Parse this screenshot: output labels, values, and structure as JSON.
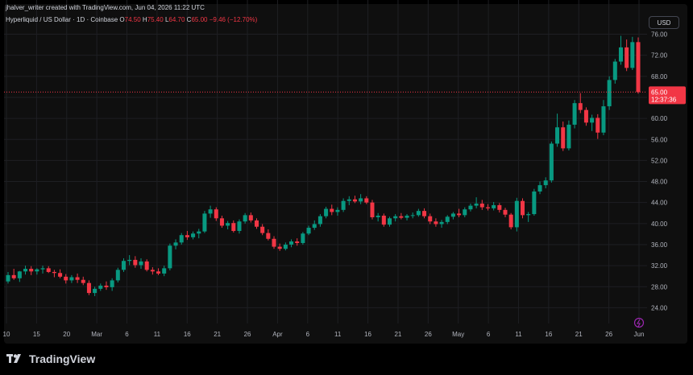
{
  "header": {
    "credit": "jhalver_writer created with TradingView.com, Jun 04, 2026 11:22 UTC",
    "symbol": "Hyperliquid / US Dollar · 1D · Coinbase",
    "open_label": "O",
    "open_value": "74.50",
    "high_label": "H",
    "high_value": "75.40",
    "low_label": "L",
    "low_value": "64.70",
    "close_label": "C",
    "close_value": "65.00",
    "change": "−9.46 (−12.70%)",
    "currency": "USD"
  },
  "branding": {
    "name": "TradingView"
  },
  "price_tag": {
    "price": "65.00",
    "countdown": "12:37:36"
  },
  "colors": {
    "up": "#089981",
    "down": "#f23645",
    "background": "#0f0f0f",
    "grid": "#1e1f23",
    "text": "#b2b5be"
  },
  "chart_data": {
    "type": "candlestick",
    "title": "Hyperliquid / US Dollar · 1D · Coinbase",
    "ylim": [
      21,
      77
    ],
    "y_ticks": [
      "24.00",
      "28.00",
      "32.00",
      "36.00",
      "40.00",
      "44.00",
      "48.00",
      "52.00",
      "56.00",
      "60.00",
      "64.00",
      "68.00",
      "72.00",
      "76.00"
    ],
    "x_tick_labels": [
      "10",
      "15",
      "20",
      "Mar",
      "6",
      "11",
      "16",
      "21",
      "26",
      "Apr",
      "6",
      "11",
      "16",
      "21",
      "26",
      "May",
      "6",
      "11",
      "16",
      "21",
      "26",
      "Jun"
    ],
    "grid": true,
    "last_price": 65.0,
    "candles": [
      {
        "o": 29.0,
        "h": 30.8,
        "l": 28.6,
        "c": 30.2
      },
      {
        "o": 30.2,
        "h": 31.4,
        "l": 29.3,
        "c": 29.6
      },
      {
        "o": 29.6,
        "h": 31.0,
        "l": 28.9,
        "c": 30.9
      },
      {
        "o": 30.9,
        "h": 32.0,
        "l": 30.3,
        "c": 31.4
      },
      {
        "o": 31.4,
        "h": 31.9,
        "l": 30.2,
        "c": 30.9
      },
      {
        "o": 30.9,
        "h": 31.5,
        "l": 30.3,
        "c": 31.3
      },
      {
        "o": 31.3,
        "h": 32.0,
        "l": 30.5,
        "c": 31.5
      },
      {
        "o": 31.5,
        "h": 31.9,
        "l": 30.6,
        "c": 30.8
      },
      {
        "o": 30.8,
        "h": 31.2,
        "l": 29.8,
        "c": 30.6
      },
      {
        "o": 30.6,
        "h": 31.3,
        "l": 29.6,
        "c": 29.9
      },
      {
        "o": 29.9,
        "h": 30.4,
        "l": 28.6,
        "c": 29.2
      },
      {
        "o": 29.2,
        "h": 30.2,
        "l": 28.7,
        "c": 29.8
      },
      {
        "o": 29.8,
        "h": 30.5,
        "l": 28.7,
        "c": 29.3
      },
      {
        "o": 29.3,
        "h": 29.9,
        "l": 28.3,
        "c": 28.7
      },
      {
        "o": 28.7,
        "h": 29.2,
        "l": 26.4,
        "c": 26.8
      },
      {
        "o": 26.8,
        "h": 28.0,
        "l": 26.2,
        "c": 27.6
      },
      {
        "o": 27.6,
        "h": 28.6,
        "l": 27.2,
        "c": 28.2
      },
      {
        "o": 28.2,
        "h": 29.0,
        "l": 27.4,
        "c": 27.9
      },
      {
        "o": 27.9,
        "h": 29.6,
        "l": 27.2,
        "c": 29.2
      },
      {
        "o": 29.2,
        "h": 31.6,
        "l": 28.8,
        "c": 31.2
      },
      {
        "o": 31.2,
        "h": 33.4,
        "l": 30.8,
        "c": 32.9
      },
      {
        "o": 32.9,
        "h": 34.0,
        "l": 32.1,
        "c": 33.1
      },
      {
        "o": 33.1,
        "h": 33.8,
        "l": 31.6,
        "c": 32.1
      },
      {
        "o": 32.1,
        "h": 33.4,
        "l": 31.4,
        "c": 32.8
      },
      {
        "o": 32.8,
        "h": 33.2,
        "l": 30.9,
        "c": 31.2
      },
      {
        "o": 31.2,
        "h": 31.7,
        "l": 30.3,
        "c": 30.9
      },
      {
        "o": 30.9,
        "h": 31.5,
        "l": 30.2,
        "c": 30.5
      },
      {
        "o": 30.5,
        "h": 32.0,
        "l": 30.0,
        "c": 31.5
      },
      {
        "o": 31.5,
        "h": 36.2,
        "l": 31.1,
        "c": 35.8
      },
      {
        "o": 35.8,
        "h": 37.0,
        "l": 35.1,
        "c": 36.4
      },
      {
        "o": 36.4,
        "h": 38.2,
        "l": 36.0,
        "c": 37.8
      },
      {
        "o": 37.8,
        "h": 38.6,
        "l": 36.9,
        "c": 37.4
      },
      {
        "o": 37.4,
        "h": 38.5,
        "l": 37.0,
        "c": 38.1
      },
      {
        "o": 38.1,
        "h": 39.0,
        "l": 37.2,
        "c": 38.5
      },
      {
        "o": 38.5,
        "h": 42.4,
        "l": 38.2,
        "c": 41.9
      },
      {
        "o": 41.9,
        "h": 43.4,
        "l": 41.1,
        "c": 42.7
      },
      {
        "o": 42.7,
        "h": 43.1,
        "l": 40.5,
        "c": 41.0
      },
      {
        "o": 41.0,
        "h": 41.5,
        "l": 39.2,
        "c": 39.6
      },
      {
        "o": 39.6,
        "h": 40.5,
        "l": 38.9,
        "c": 40.1
      },
      {
        "o": 40.1,
        "h": 40.6,
        "l": 38.3,
        "c": 38.6
      },
      {
        "o": 38.6,
        "h": 40.8,
        "l": 38.1,
        "c": 40.4
      },
      {
        "o": 40.4,
        "h": 42.0,
        "l": 40.0,
        "c": 41.6
      },
      {
        "o": 41.6,
        "h": 42.1,
        "l": 40.2,
        "c": 40.6
      },
      {
        "o": 40.6,
        "h": 41.0,
        "l": 39.0,
        "c": 39.4
      },
      {
        "o": 39.4,
        "h": 39.9,
        "l": 37.8,
        "c": 38.2
      },
      {
        "o": 38.2,
        "h": 38.9,
        "l": 36.8,
        "c": 37.1
      },
      {
        "o": 37.1,
        "h": 37.6,
        "l": 35.2,
        "c": 35.6
      },
      {
        "o": 35.6,
        "h": 36.2,
        "l": 34.8,
        "c": 35.2
      },
      {
        "o": 35.2,
        "h": 36.4,
        "l": 34.9,
        "c": 36.0
      },
      {
        "o": 36.0,
        "h": 37.0,
        "l": 35.5,
        "c": 36.6
      },
      {
        "o": 36.6,
        "h": 37.2,
        "l": 35.8,
        "c": 36.3
      },
      {
        "o": 36.3,
        "h": 38.4,
        "l": 36.0,
        "c": 38.1
      },
      {
        "o": 38.1,
        "h": 39.6,
        "l": 37.8,
        "c": 39.2
      },
      {
        "o": 39.2,
        "h": 40.6,
        "l": 38.8,
        "c": 39.9
      },
      {
        "o": 39.9,
        "h": 41.8,
        "l": 39.4,
        "c": 41.4
      },
      {
        "o": 41.4,
        "h": 43.2,
        "l": 41.0,
        "c": 42.8
      },
      {
        "o": 42.8,
        "h": 43.6,
        "l": 41.6,
        "c": 42.2
      },
      {
        "o": 42.2,
        "h": 43.1,
        "l": 41.5,
        "c": 42.6
      },
      {
        "o": 42.6,
        "h": 44.8,
        "l": 42.2,
        "c": 44.3
      },
      {
        "o": 44.3,
        "h": 45.2,
        "l": 43.5,
        "c": 44.6
      },
      {
        "o": 44.6,
        "h": 45.3,
        "l": 43.9,
        "c": 44.2
      },
      {
        "o": 44.2,
        "h": 45.6,
        "l": 43.7,
        "c": 44.8
      },
      {
        "o": 44.8,
        "h": 45.2,
        "l": 43.7,
        "c": 44.0
      },
      {
        "o": 44.0,
        "h": 44.5,
        "l": 40.8,
        "c": 41.2
      },
      {
        "o": 41.2,
        "h": 42.0,
        "l": 40.4,
        "c": 41.5
      },
      {
        "o": 41.5,
        "h": 41.9,
        "l": 39.4,
        "c": 39.8
      },
      {
        "o": 39.8,
        "h": 41.3,
        "l": 39.4,
        "c": 41.0
      },
      {
        "o": 41.0,
        "h": 41.8,
        "l": 40.4,
        "c": 41.4
      },
      {
        "o": 41.4,
        "h": 42.0,
        "l": 40.8,
        "c": 41.1
      },
      {
        "o": 41.1,
        "h": 41.8,
        "l": 40.6,
        "c": 41.5
      },
      {
        "o": 41.5,
        "h": 42.1,
        "l": 41.0,
        "c": 41.6
      },
      {
        "o": 41.6,
        "h": 42.8,
        "l": 41.3,
        "c": 42.4
      },
      {
        "o": 42.4,
        "h": 42.9,
        "l": 41.0,
        "c": 41.4
      },
      {
        "o": 41.4,
        "h": 41.9,
        "l": 39.9,
        "c": 40.4
      },
      {
        "o": 40.4,
        "h": 41.0,
        "l": 39.4,
        "c": 39.9
      },
      {
        "o": 39.9,
        "h": 40.7,
        "l": 39.2,
        "c": 40.3
      },
      {
        "o": 40.3,
        "h": 41.6,
        "l": 39.9,
        "c": 41.3
      },
      {
        "o": 41.3,
        "h": 42.2,
        "l": 40.8,
        "c": 41.9
      },
      {
        "o": 41.9,
        "h": 42.8,
        "l": 41.2,
        "c": 41.6
      },
      {
        "o": 41.6,
        "h": 43.1,
        "l": 41.2,
        "c": 42.7
      },
      {
        "o": 42.7,
        "h": 43.8,
        "l": 42.3,
        "c": 43.4
      },
      {
        "o": 43.4,
        "h": 45.0,
        "l": 42.9,
        "c": 43.8
      },
      {
        "o": 43.8,
        "h": 44.5,
        "l": 42.6,
        "c": 43.1
      },
      {
        "o": 43.1,
        "h": 43.7,
        "l": 42.5,
        "c": 42.9
      },
      {
        "o": 42.9,
        "h": 44.1,
        "l": 42.5,
        "c": 43.5
      },
      {
        "o": 43.5,
        "h": 43.9,
        "l": 42.1,
        "c": 42.6
      },
      {
        "o": 42.6,
        "h": 43.0,
        "l": 41.2,
        "c": 41.7
      },
      {
        "o": 41.7,
        "h": 42.0,
        "l": 38.9,
        "c": 39.3
      },
      {
        "o": 39.3,
        "h": 44.9,
        "l": 38.5,
        "c": 44.3
      },
      {
        "o": 44.3,
        "h": 44.8,
        "l": 41.0,
        "c": 41.6
      },
      {
        "o": 41.6,
        "h": 42.2,
        "l": 40.3,
        "c": 41.8
      },
      {
        "o": 41.8,
        "h": 46.6,
        "l": 41.5,
        "c": 46.1
      },
      {
        "o": 46.1,
        "h": 48.0,
        "l": 45.6,
        "c": 47.3
      },
      {
        "o": 47.3,
        "h": 48.8,
        "l": 46.7,
        "c": 48.2
      },
      {
        "o": 48.2,
        "h": 55.6,
        "l": 47.8,
        "c": 55.2
      },
      {
        "o": 55.2,
        "h": 60.9,
        "l": 54.6,
        "c": 58.3
      },
      {
        "o": 58.3,
        "h": 59.4,
        "l": 53.8,
        "c": 54.3
      },
      {
        "o": 54.3,
        "h": 59.6,
        "l": 53.9,
        "c": 58.8
      },
      {
        "o": 58.8,
        "h": 63.5,
        "l": 58.1,
        "c": 62.9
      },
      {
        "o": 62.9,
        "h": 64.8,
        "l": 61.0,
        "c": 61.6
      },
      {
        "o": 61.6,
        "h": 62.1,
        "l": 58.6,
        "c": 59.2
      },
      {
        "o": 59.2,
        "h": 60.7,
        "l": 57.6,
        "c": 60.1
      },
      {
        "o": 60.1,
        "h": 60.8,
        "l": 56.1,
        "c": 57.3
      },
      {
        "o": 57.3,
        "h": 63.5,
        "l": 56.8,
        "c": 62.3
      },
      {
        "o": 62.3,
        "h": 68.0,
        "l": 61.6,
        "c": 67.3
      },
      {
        "o": 67.3,
        "h": 71.3,
        "l": 66.6,
        "c": 70.8
      },
      {
        "o": 70.8,
        "h": 75.7,
        "l": 70.2,
        "c": 73.5
      },
      {
        "o": 73.5,
        "h": 75.0,
        "l": 69.0,
        "c": 69.6
      },
      {
        "o": 69.6,
        "h": 75.5,
        "l": 69.2,
        "c": 74.5
      },
      {
        "o": 74.5,
        "h": 75.4,
        "l": 64.7,
        "c": 65.0
      }
    ]
  }
}
